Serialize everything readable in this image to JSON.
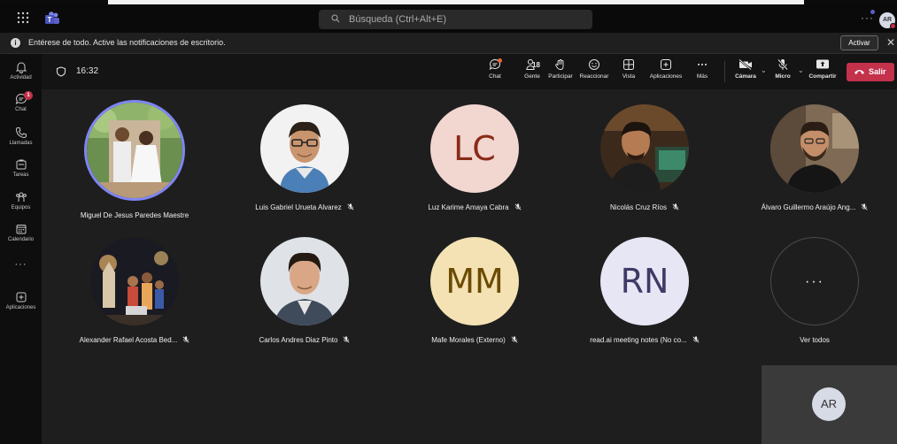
{
  "app": {
    "search_placeholder": "Búsqueda (Ctrl+Alt+E)",
    "account_initials": "AR"
  },
  "notification": {
    "message": "Entérese de todo. Active las notificaciones de escritorio.",
    "action_label": "Activar"
  },
  "rail": {
    "items": [
      {
        "label": "Actividad",
        "icon": "bell-icon"
      },
      {
        "label": "Chat",
        "icon": "chat-icon",
        "badge": "1"
      },
      {
        "label": "Llamadas",
        "icon": "phone-icon"
      },
      {
        "label": "Tareas",
        "icon": "tasks-icon"
      },
      {
        "label": "Equipos",
        "icon": "teams-icon"
      },
      {
        "label": "Calendario",
        "icon": "calendar-icon"
      },
      {
        "label": "Aplicaciones",
        "icon": "apps-icon"
      }
    ],
    "more_label": "···"
  },
  "meeting_bar": {
    "time": "16:32",
    "controls": {
      "chat": "Chat",
      "people": "Gente",
      "people_count": "18",
      "raise": "Participar",
      "react": "Reaccionar",
      "view": "Vista",
      "apps": "Aplicaciones",
      "more": "Más",
      "camera": "Cámara",
      "mic": "Micro",
      "share": "Compartir"
    },
    "leave_label": "Salir"
  },
  "participants": [
    {
      "name": "Miguel De Jesus Paredes Maestre",
      "type": "photo",
      "photo": "wedding",
      "muted": false,
      "speaking": true
    },
    {
      "name": "Luis Gabriel Urueta Alvarez",
      "type": "photo",
      "photo": "glasses",
      "muted": true
    },
    {
      "name": "Luz Karime Amaya Cabra",
      "type": "initials",
      "initials": "LC",
      "bg": "#f2d6d0",
      "fg": "#8a2a18",
      "muted": true
    },
    {
      "name": "Nicolás Cruz Ríos",
      "type": "photo",
      "photo": "studio",
      "muted": true
    },
    {
      "name": "Álvaro Guillermo Araújo Ang...",
      "type": "photo",
      "photo": "beard",
      "muted": true
    },
    {
      "name": "Alexander Rafael Acosta Bed...",
      "type": "photo",
      "photo": "night",
      "muted": true
    },
    {
      "name": "Carlos Andres Diaz Pinto",
      "type": "photo",
      "photo": "suit",
      "muted": true
    },
    {
      "name": "Mafe Morales (Externo)",
      "type": "initials",
      "initials": "MM",
      "bg": "#f4e2b4",
      "fg": "#6b4a00",
      "muted": true
    },
    {
      "name": "read.ai meeting notes (No co...",
      "type": "initials",
      "initials": "RN",
      "bg": "#e7e6f5",
      "fg": "#3f3a66",
      "muted": true
    },
    {
      "name": "Ver todos",
      "type": "more",
      "label": "···"
    }
  ],
  "self_view": {
    "initials": "AR"
  },
  "colors": {
    "accent": "#5b5fc7",
    "leave": "#c4314b",
    "stage_bg": "#1e1e1e",
    "toolbar_bg": "#141414"
  }
}
